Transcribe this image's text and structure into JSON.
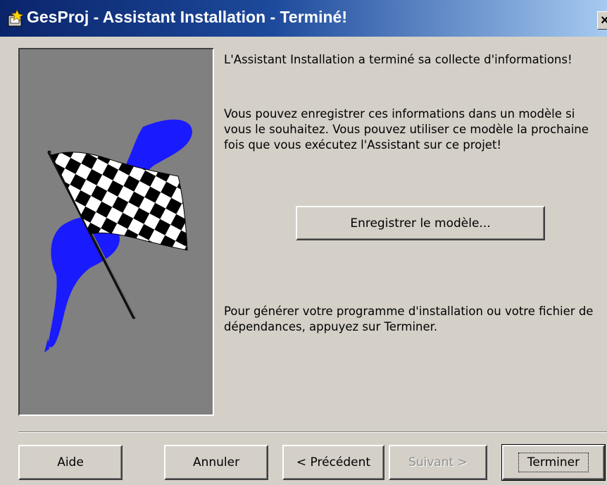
{
  "window": {
    "title": "GesProj - Assistant Installation - Terminé!",
    "close_label": "×"
  },
  "content": {
    "paragraph_1": "L'Assistant Installation a terminé sa collecte d'informations!",
    "paragraph_2": "Vous pouvez enregistrer ces informations dans un modèle si vous le souhaitez. Vous pouvez utiliser ce modèle la prochaine fois que vous exécutez l'Assistant sur ce projet!",
    "save_template_label": "Enregistrer le modèle...",
    "paragraph_3": "Pour générer votre programme d'installation ou votre fichier de dépendances, appuyez sur Terminer."
  },
  "buttons": {
    "help": "Aide",
    "cancel": "Annuler",
    "previous": "< Précédent",
    "next": "Suivant >",
    "finish": "Terminer"
  },
  "icons": {
    "app": "app-icon",
    "illustration": "checkered-flag-icon"
  },
  "colors": {
    "dialog_bg": "#d4d0c8",
    "titlebar_start": "#0a246a",
    "titlebar_end": "#a6caf0",
    "image_bg": "#808080",
    "brush_stroke": "#1a1aff"
  }
}
